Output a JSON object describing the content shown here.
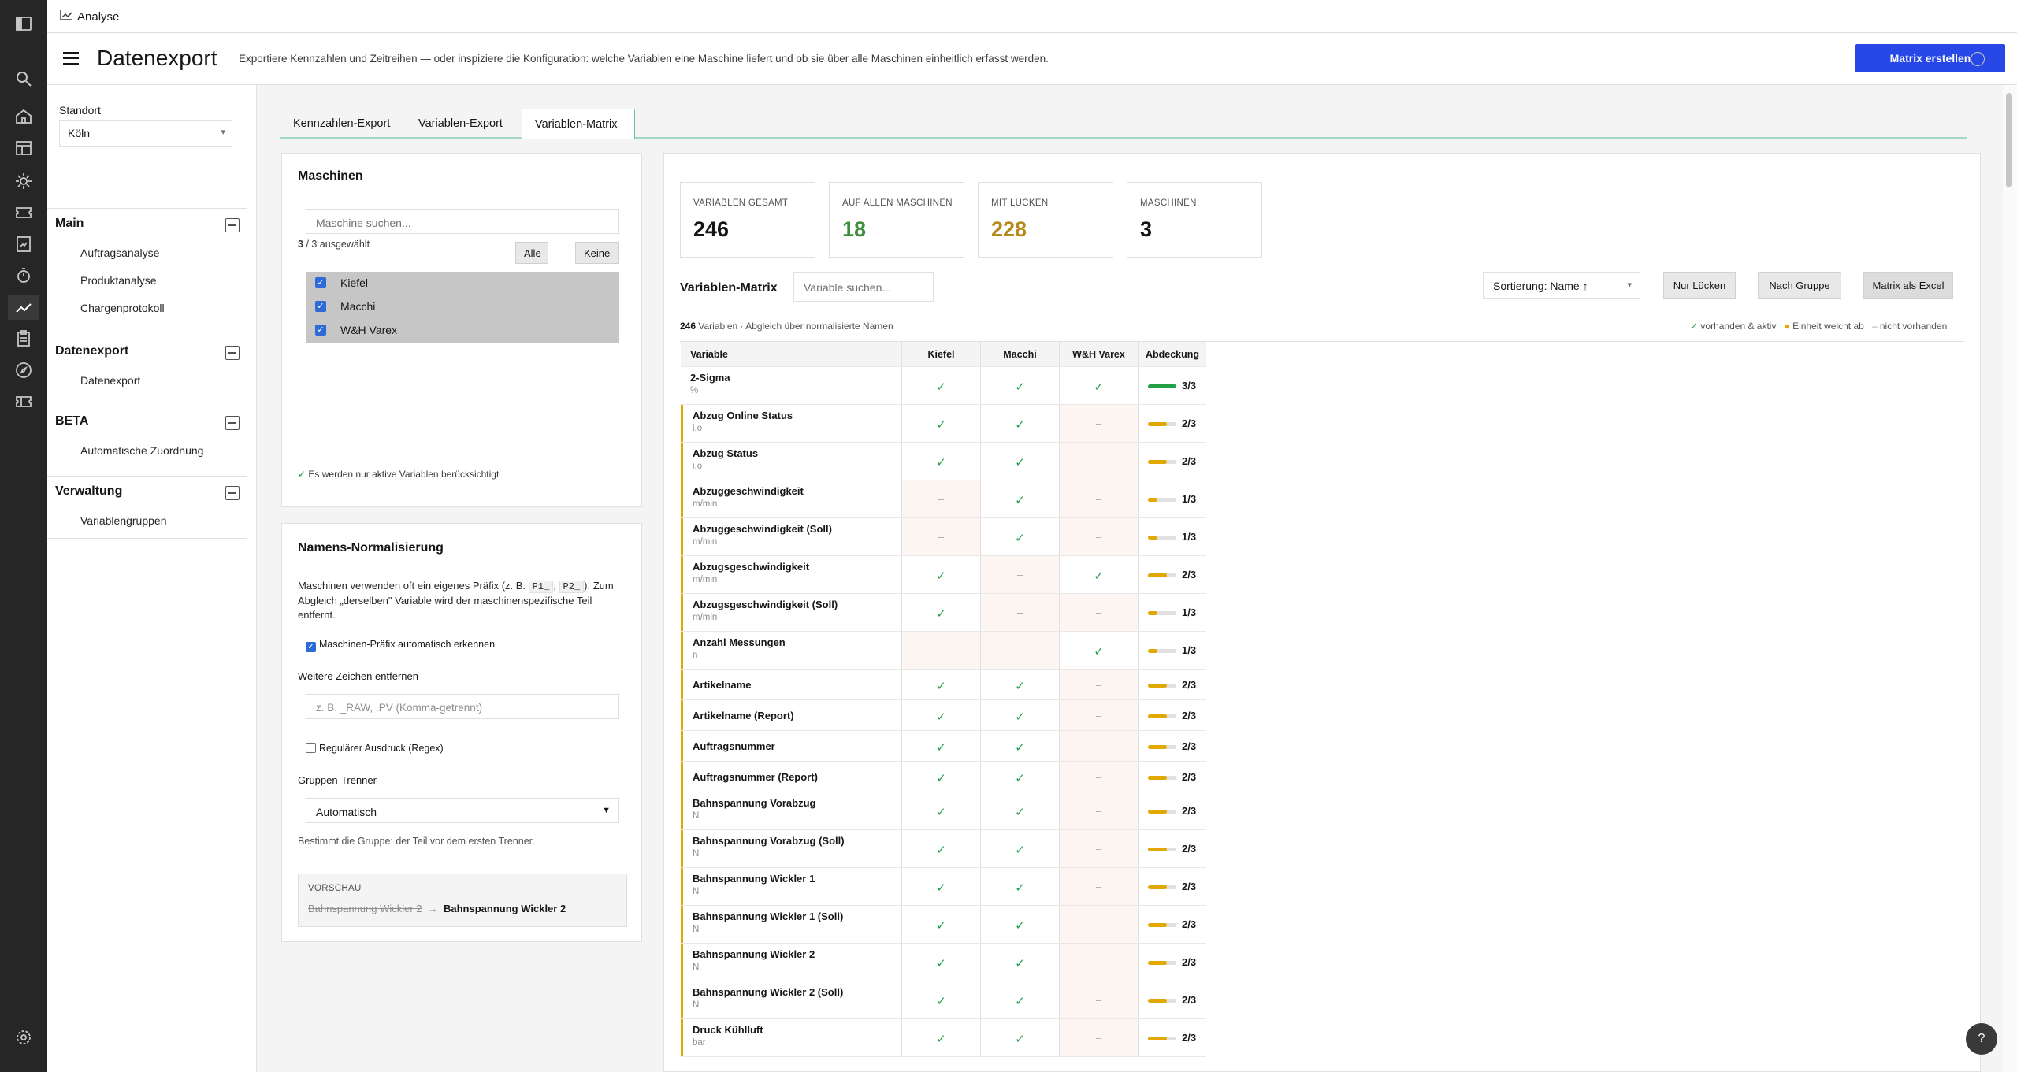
{
  "topbar": {
    "crumb": "Analyse"
  },
  "header": {
    "title": "Datenexport",
    "description": "Exportiere Kennzahlen und Zeitreihen — oder inspiziere die Konfiguration: welche Variablen eine Maschine liefert und ob sie über alle Maschinen einheitlich erfasst werden.",
    "primary_button": "Matrix erstellen"
  },
  "sidebar": {
    "location_label": "Standort",
    "location_value": "Köln",
    "groups": [
      {
        "title": "Main",
        "items": [
          "Auftragsanalyse",
          "Produktanalyse",
          "Chargenprotokoll"
        ]
      },
      {
        "title": "Datenexport",
        "items": [
          "Datenexport"
        ]
      },
      {
        "title": "BETA",
        "items": [
          "Automatische Zuordnung"
        ]
      },
      {
        "title": "Verwaltung",
        "items": [
          "Variablengruppen"
        ]
      }
    ]
  },
  "tabs": [
    "Kennzahlen-Export",
    "Variablen-Export",
    "Variablen-Matrix"
  ],
  "machines": {
    "title": "Maschinen",
    "search_placeholder": "Maschine suchen...",
    "selected_count": "3",
    "selected_rest": "/ 3 ausgewählt",
    "all_button": "Alle",
    "none_button": "Keine",
    "list": [
      "Kiefel",
      "Macchi",
      "W&H Varex"
    ],
    "note": "Es werden nur aktive Variablen berücksichtigt"
  },
  "normalization": {
    "title": "Namens-Normalisierung",
    "desc_1": "Maschinen verwenden oft ein eigenes Präfix (z. B.",
    "code_1": "P1_",
    "code_sep": ",",
    "code_2": "P2_",
    "desc_2": "). Zum",
    "desc_3": "Abgleich „derselben\" Variable wird der maschinenspezifische Teil",
    "desc_4": "entfernt.",
    "auto_prefix_label": "Maschinen-Präfix automatisch erkennen",
    "remove_label": "Weitere Zeichen entfernen",
    "remove_placeholder": "z. B. _RAW, .PV  (Komma-getrennt)",
    "regex_label": "Regulärer Ausdruck (Regex)",
    "separator_label": "Gruppen-Trenner",
    "separator_value": "Automatisch",
    "separator_hint": "Bestimmt die Gruppe: der Teil vor dem ersten Trenner.",
    "preview_label": "VORSCHAU",
    "preview_before": "Bahnspannung Wickler 2",
    "preview_arrow": "→",
    "preview_after": "Bahnspannung Wickler 2"
  },
  "stats": [
    {
      "label": "VARIABLEN GESAMT",
      "value": "246",
      "color": "#161616"
    },
    {
      "label": "AUF ALLEN MASCHINEN",
      "value": "18",
      "color": "#3f8f3f"
    },
    {
      "label": "MIT LÜCKEN",
      "value": "228",
      "color": "#b58a1a"
    },
    {
      "label": "MASCHINEN",
      "value": "3",
      "color": "#161616"
    }
  ],
  "matrix": {
    "title": "Variablen-Matrix",
    "search_placeholder": "Variable suchen...",
    "sort_value": "Sortierung: Name ↑",
    "only_gaps_button": "Nur Lücken",
    "by_group_button": "Nach Gruppe",
    "excel_button": "Matrix als Excel",
    "count": "246",
    "count_suffix": "Variablen · Abgleich über normalisierte Namen",
    "legend_present": "vorhanden & aktiv",
    "legend_unit": "Einheit weicht ab",
    "legend_absent": "nicht vorhanden",
    "columns": [
      "Variable",
      "Kiefel",
      "Macchi",
      "W&H Varex",
      "Abdeckung"
    ],
    "rows": [
      {
        "name": "2-Sigma",
        "unit": "%",
        "k": true,
        "m": true,
        "w": true,
        "cov": "3/3",
        "frac": 1
      },
      {
        "name": "Abzug Online Status",
        "unit": "i.o",
        "k": true,
        "m": true,
        "w": false,
        "cov": "2/3",
        "frac": 0.667
      },
      {
        "name": "Abzug Status",
        "unit": "i.o",
        "k": true,
        "m": true,
        "w": false,
        "cov": "2/3",
        "frac": 0.667
      },
      {
        "name": "Abzuggeschwindigkeit",
        "unit": "m/min",
        "k": false,
        "m": true,
        "w": false,
        "cov": "1/3",
        "frac": 0.333
      },
      {
        "name": "Abzuggeschwindigkeit (Soll)",
        "unit": "m/min",
        "k": false,
        "m": true,
        "w": false,
        "cov": "1/3",
        "frac": 0.333
      },
      {
        "name": "Abzugsgeschwindigkeit",
        "unit": "m/min",
        "k": true,
        "m": false,
        "w": true,
        "cov": "2/3",
        "frac": 0.667
      },
      {
        "name": "Abzugsgeschwindigkeit (Soll)",
        "unit": "m/min",
        "k": true,
        "m": false,
        "w": false,
        "cov": "1/3",
        "frac": 0.333
      },
      {
        "name": "Anzahl Messungen",
        "unit": "n",
        "k": false,
        "m": false,
        "w": true,
        "cov": "1/3",
        "frac": 0.333
      },
      {
        "name": "Artikelname",
        "unit": "",
        "k": true,
        "m": true,
        "w": false,
        "cov": "2/3",
        "frac": 0.667
      },
      {
        "name": "Artikelname (Report)",
        "unit": "",
        "k": true,
        "m": true,
        "w": false,
        "cov": "2/3",
        "frac": 0.667
      },
      {
        "name": "Auftragsnummer",
        "unit": "",
        "k": true,
        "m": true,
        "w": false,
        "cov": "2/3",
        "frac": 0.667
      },
      {
        "name": "Auftragsnummer (Report)",
        "unit": "",
        "k": true,
        "m": true,
        "w": false,
        "cov": "2/3",
        "frac": 0.667
      },
      {
        "name": "Bahnspannung Vorabzug",
        "unit": "N",
        "k": true,
        "m": true,
        "w": false,
        "cov": "2/3",
        "frac": 0.667
      },
      {
        "name": "Bahnspannung Vorabzug (Soll)",
        "unit": "N",
        "k": true,
        "m": true,
        "w": false,
        "cov": "2/3",
        "frac": 0.667
      },
      {
        "name": "Bahnspannung Wickler 1",
        "unit": "N",
        "k": true,
        "m": true,
        "w": false,
        "cov": "2/3",
        "frac": 0.667
      },
      {
        "name": "Bahnspannung Wickler 1 (Soll)",
        "unit": "N",
        "k": true,
        "m": true,
        "w": false,
        "cov": "2/3",
        "frac": 0.667
      },
      {
        "name": "Bahnspannung Wickler 2",
        "unit": "N",
        "k": true,
        "m": true,
        "w": false,
        "cov": "2/3",
        "frac": 0.667
      },
      {
        "name": "Bahnspannung Wickler 2 (Soll)",
        "unit": "N",
        "k": true,
        "m": true,
        "w": false,
        "cov": "2/3",
        "frac": 0.667
      },
      {
        "name": "Druck Kühlluft",
        "unit": "bar",
        "k": true,
        "m": true,
        "w": false,
        "cov": "2/3",
        "frac": 0.667
      }
    ],
    "check_glyph": "✓",
    "dash_glyph": "–",
    "full_color": "#24a148",
    "partial_color": "#e0a800"
  },
  "help_glyph": "?"
}
